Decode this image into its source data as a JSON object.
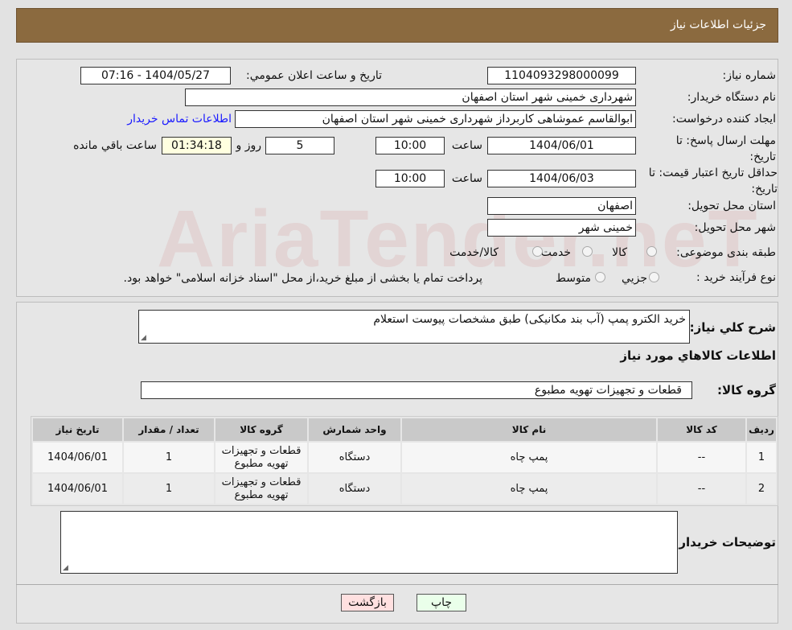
{
  "header": {
    "title": "جزئیات اطلاعات نیاز"
  },
  "watermark": "AriaTender.neT",
  "form": {
    "need_number_label": "شماره نیاز:",
    "need_number": "1104093298000099",
    "announce_label": "تاریخ و ساعت اعلان عمومي:",
    "announce_value": "1404/05/27 - 07:16",
    "buyer_org_label": "نام دستگاه خریدار:",
    "buyer_org": "شهرداری خمینی شهر استان اصفهان",
    "creator_label": "ایجاد کننده درخواست:",
    "creator": "ابوالقاسم عموشاهی کاربرداز شهرداری خمینی شهر استان اصفهان",
    "contact_link": "اطلاعات تماس خریدار",
    "deadline_label": "مهلت ارسال پاسخ: تا تاریخ:",
    "deadline_date": "1404/06/01",
    "time_label": "ساعت",
    "deadline_time": "10:00",
    "days": "5",
    "days_label": "روز و",
    "remaining": "01:34:18",
    "remaining_label": "ساعت باقي مانده",
    "validity_label": "حداقل تاریخ اعتبار قیمت: تا تاریخ:",
    "validity_date": "1404/06/03",
    "validity_time": "10:00",
    "province_label": "استان محل تحویل:",
    "province": "اصفهان",
    "city_label": "شهر محل تحویل:",
    "city": "خمینی شهر",
    "category_label": "طبقه بندی موضوعی:",
    "category_options": [
      "کالا",
      "خدمت",
      "کالا/خدمت"
    ],
    "process_label": "نوع فرآیند خرید :",
    "process_options": [
      "جزيي",
      "متوسط"
    ],
    "process_note": "پرداخت تمام یا بخشی از مبلغ خرید،از محل \"اسناد خزانه اسلامی\" خواهد بود."
  },
  "details": {
    "summary_label": "شرح کلي نیاز:",
    "summary": "خرید الکترو پمپ (آب بند مکانیکی) طبق مشخصات پیوست استعلام",
    "goods_heading": "اطلاعات کالاهاي مورد نیاز",
    "group_label": "گروه کالا:",
    "group": "قطعات و تجهیزات تهویه مطبوع",
    "table": {
      "headers": [
        "ردیف",
        "کد کالا",
        "نام کالا",
        "واحد شمارش",
        "گروه کالا",
        "تعداد / مقدار",
        "تاریخ نیاز"
      ],
      "rows": [
        [
          "1",
          "--",
          "پمپ چاه",
          "دستگاه",
          "قطعات و تجهیزات تهویه مطبوع",
          "1",
          "1404/06/01"
        ],
        [
          "2",
          "--",
          "پمپ چاه",
          "دستگاه",
          "قطعات و تجهیزات تهویه مطبوع",
          "1",
          "1404/06/01"
        ]
      ]
    },
    "buyer_notes_label": "توضیحات خریدار:",
    "buyer_notes": ""
  },
  "buttons": {
    "print": "چاپ",
    "back": "بازگشت"
  }
}
